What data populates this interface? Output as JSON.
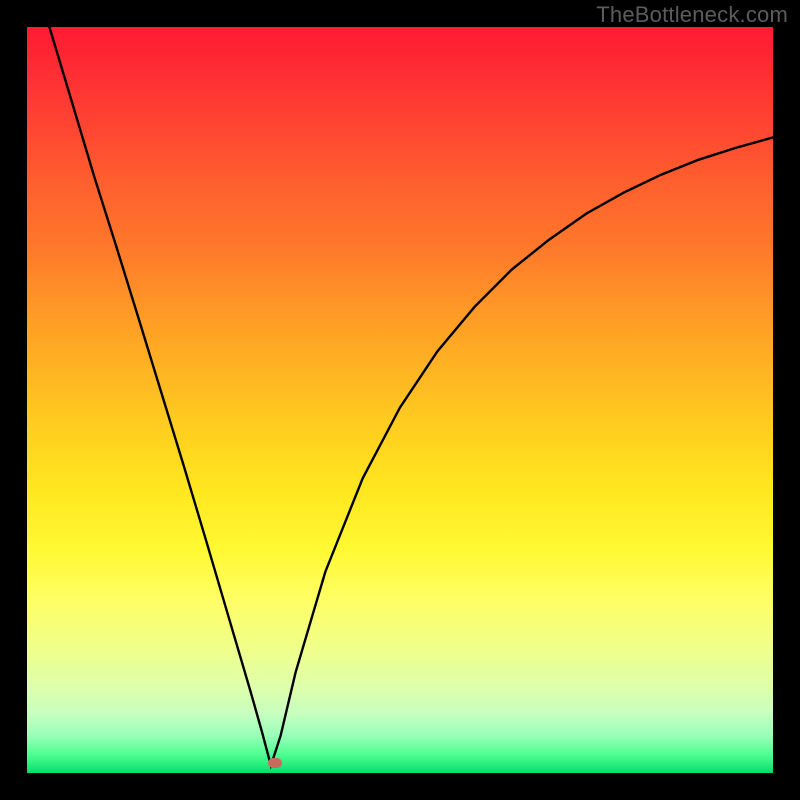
{
  "watermark": "TheBottleneck.com",
  "marker": {
    "x_pct": 0.332,
    "y_pct": 0.986
  },
  "chart_data": {
    "type": "line",
    "title": "",
    "xlabel": "",
    "ylabel": "",
    "xlim": [
      0,
      1
    ],
    "ylim": [
      0,
      1
    ],
    "note": "Values are normalized fractions of the plot area (0=left/bottom, 1=right/top). Single V-shaped bottleneck curve with minimum near x≈0.33.",
    "series": [
      {
        "name": "bottleneck-curve",
        "x": [
          0.03,
          0.06,
          0.09,
          0.12,
          0.15,
          0.18,
          0.21,
          0.24,
          0.27,
          0.3,
          0.315,
          0.327,
          0.34,
          0.36,
          0.4,
          0.45,
          0.5,
          0.55,
          0.6,
          0.65,
          0.7,
          0.75,
          0.8,
          0.85,
          0.9,
          0.95,
          1.0
        ],
        "y": [
          1.0,
          0.9,
          0.8,
          0.705,
          0.608,
          0.51,
          0.412,
          0.312,
          0.21,
          0.108,
          0.055,
          0.01,
          0.05,
          0.135,
          0.27,
          0.395,
          0.49,
          0.565,
          0.625,
          0.675,
          0.715,
          0.75,
          0.778,
          0.802,
          0.822,
          0.838,
          0.852
        ]
      }
    ],
    "marker": {
      "x": 0.332,
      "y": 0.014
    }
  }
}
